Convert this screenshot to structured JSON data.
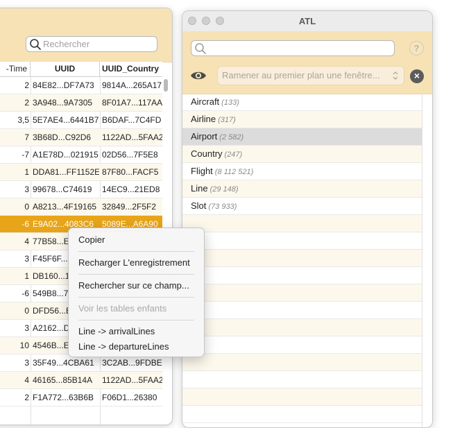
{
  "left_window": {
    "search_placeholder": "Rechercher",
    "columns": [
      "-Time",
      "UUID",
      "UUID_Country"
    ],
    "rows": [
      {
        "time": "2",
        "uuid": "84E82...DF7A73",
        "uuid_country": "9814A...265A17"
      },
      {
        "time": "2",
        "uuid": "3A948...9A7305",
        "uuid_country": "8F01A7...117AA"
      },
      {
        "time": "3,5",
        "uuid": "5E7AE4...6441B7",
        "uuid_country": "B6DAF...7C4FD"
      },
      {
        "time": "7",
        "uuid": "3B68D...C92D6",
        "uuid_country": "1122AD...5FAA2"
      },
      {
        "time": "-7",
        "uuid": "A1E78D...021915",
        "uuid_country": "02D56...7F5E8"
      },
      {
        "time": "1",
        "uuid": "DDA81...FF1152E",
        "uuid_country": "87F80...FACF5"
      },
      {
        "time": "3",
        "uuid": "99678...C74619",
        "uuid_country": "14EC9...21ED8"
      },
      {
        "time": "0",
        "uuid": "A8213...4F19165",
        "uuid_country": "32849...2F5F2"
      },
      {
        "time": "-6",
        "uuid": "E9A02...4083C6",
        "uuid_country": "5089E...A6A90"
      },
      {
        "time": "4",
        "uuid": "77B58...E",
        "uuid_country": ""
      },
      {
        "time": "3",
        "uuid": "F45F6F...",
        "uuid_country": ""
      },
      {
        "time": "1",
        "uuid": "DB160...1",
        "uuid_country": ""
      },
      {
        "time": "-6",
        "uuid": "549B8...7",
        "uuid_country": ""
      },
      {
        "time": "0",
        "uuid": "DFD56...E",
        "uuid_country": ""
      },
      {
        "time": "3",
        "uuid": "A2162...D",
        "uuid_country": ""
      },
      {
        "time": "10",
        "uuid": "4546B...E",
        "uuid_country": ""
      },
      {
        "time": "3",
        "uuid": "35F49...4CBA61",
        "uuid_country": "3C2AB...9FDBE"
      },
      {
        "time": "4",
        "uuid": "46165...85B14A",
        "uuid_country": "1122AD...5FAA2"
      },
      {
        "time": "2",
        "uuid": "F1A772...63B6B",
        "uuid_country": "F06D1...26380"
      }
    ],
    "selected_row": 8
  },
  "right_window": {
    "title": "ATL",
    "search_value": "",
    "help_label": "?",
    "front_placeholder": "Ramener au premier plan une fenêtre...",
    "close_label": "×",
    "tables": [
      {
        "name": "Aircraft",
        "count": "(133)"
      },
      {
        "name": "Airline",
        "count": "(317)"
      },
      {
        "name": "Airport",
        "count": "(2 582)"
      },
      {
        "name": "Country",
        "count": "(247)"
      },
      {
        "name": "Flight",
        "count": "(8 112 521)"
      },
      {
        "name": "Line",
        "count": "(29 148)"
      },
      {
        "name": "Slot",
        "count": "(73 933)"
      }
    ],
    "selected_table": 2
  },
  "context_menu": {
    "copy": "Copier",
    "reload": "Recharger L'enregistrement",
    "search_field": "Rechercher sur ce champ...",
    "child_tables": "Voir les tables enfants",
    "arrival_lines": "Line -> arrivalLines",
    "departure_lines": "Line -> departureLines"
  },
  "colors": {
    "toolbar": "#f7e2b6",
    "selection": "#e8a51a",
    "alt_row": "#fdf8ec"
  },
  "icons": [
    "search-icon",
    "help-icon",
    "eye-icon",
    "chevron-updown-icon",
    "close-icon"
  ]
}
